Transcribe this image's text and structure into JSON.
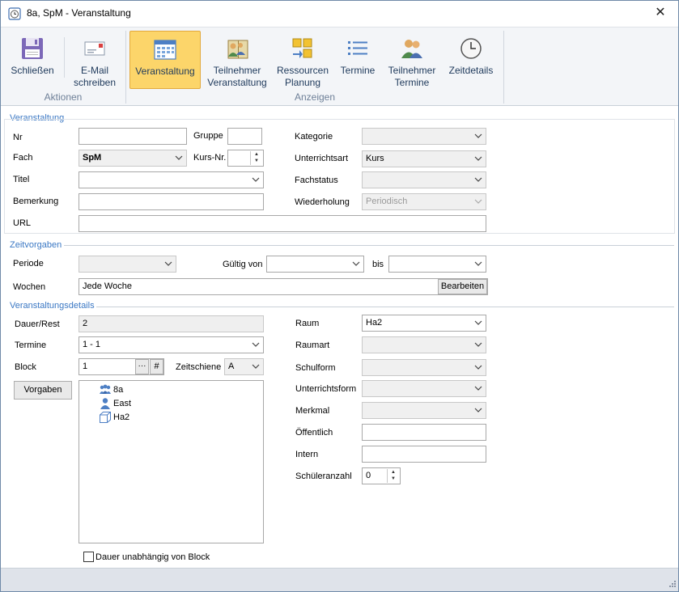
{
  "window": {
    "title": "8a, SpM - Veranstaltung",
    "close_glyph": "✕"
  },
  "ribbon": {
    "groups": [
      {
        "label": "Aktionen"
      },
      {
        "label": "Anzeigen"
      }
    ],
    "buttons": [
      {
        "line1": "Schließen",
        "line2": "",
        "icon": "floppy-disk-icon"
      },
      {
        "line1": "E-Mail",
        "line2": "schreiben",
        "icon": "email-icon"
      },
      {
        "line1": "Veranstaltung",
        "line2": "",
        "icon": "calendar-icon",
        "active": true
      },
      {
        "line1": "Teilnehmer",
        "line2": "Veranstaltung",
        "icon": "participants-book-icon"
      },
      {
        "line1": "Ressourcen",
        "line2": "Planung",
        "icon": "resources-planning-icon"
      },
      {
        "line1": "Termine",
        "line2": "",
        "icon": "list-icon"
      },
      {
        "line1": "Teilnehmer",
        "line2": "Termine",
        "icon": "participants-icon"
      },
      {
        "line1": "Zeitdetails",
        "line2": "",
        "icon": "clock-icon"
      }
    ]
  },
  "veranstaltung": {
    "section_title": "Veranstaltung",
    "nr_label": "Nr",
    "nr_value": "",
    "gruppe_label": "Gruppe",
    "gruppe_value": "",
    "kategorie_label": "Kategorie",
    "kategorie_value": "",
    "fach_label": "Fach",
    "fach_value": "SpM",
    "kursnr_label": "Kurs-Nr.",
    "kursnr_value": "",
    "unterrichtsart_label": "Unterrichtsart",
    "unterrichtsart_value": "Kurs",
    "titel_label": "Titel",
    "titel_value": "",
    "fachstatus_label": "Fachstatus",
    "fachstatus_value": "",
    "bemerkung_label": "Bemerkung",
    "bemerkung_value": "",
    "wiederholung_label": "Wiederholung",
    "wiederholung_value": "Periodisch",
    "url_label": "URL",
    "url_value": ""
  },
  "zeitvorgaben": {
    "section_title": "Zeitvorgaben",
    "periode_label": "Periode",
    "periode_value": "",
    "gueltig_von_label": "Gültig von",
    "gueltig_von_value": "",
    "bis_label": "bis",
    "bis_value": "",
    "wochen_label": "Wochen",
    "wochen_value": "Jede Woche",
    "bearbeiten_label": "Bearbeiten"
  },
  "details": {
    "section_title": "Veranstaltungsdetails",
    "dauer_label": "Dauer/Rest",
    "dauer_value": "2",
    "termine_label": "Termine",
    "termine_value": "1 - 1",
    "block_label": "Block",
    "block_value": "1",
    "block_dots": "···",
    "block_hash": "#",
    "zeitschiene_label": "Zeitschiene",
    "zeitschiene_value": "A",
    "vorgaben_label": "Vorgaben",
    "tree": [
      {
        "label": "8a",
        "icon": "class-group-icon"
      },
      {
        "label": "East",
        "icon": "teacher-person-icon"
      },
      {
        "label": "Ha2",
        "icon": "room-cube-icon"
      }
    ],
    "dauer_checkbox_label": "Dauer unabhängig von Block",
    "raum_label": "Raum",
    "raum_value": "Ha2",
    "raumart_label": "Raumart",
    "raumart_value": "",
    "schulform_label": "Schulform",
    "schulform_value": "",
    "unterrichtsform_label": "Unterrichtsform",
    "unterrichtsform_value": "",
    "merkmal_label": "Merkmal",
    "merkmal_value": "",
    "oeffentlich_label": "Öffentlich",
    "oeffentlich_value": "",
    "intern_label": "Intern",
    "intern_value": "",
    "schueleranzahl_label": "Schüleranzahl",
    "schueleranzahl_value": "0"
  }
}
